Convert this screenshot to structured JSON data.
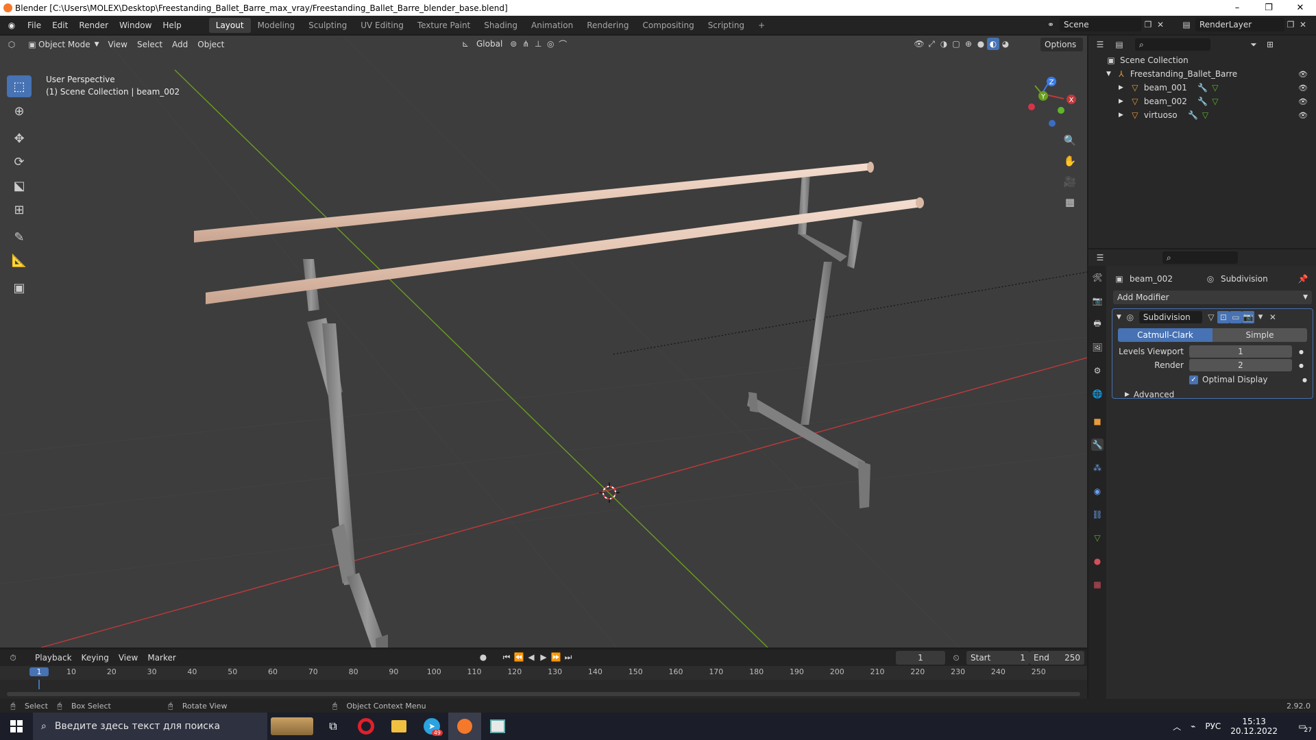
{
  "window": {
    "title": "Blender [C:\\Users\\MOLEX\\Desktop\\Freestanding_Ballet_Barre_max_vray/Freestanding_Ballet_Barre_blender_base.blend]",
    "minimize": "–",
    "maximize": "❐",
    "close": "✕"
  },
  "menu": {
    "items": [
      "File",
      "Edit",
      "Render",
      "Window",
      "Help"
    ],
    "workspaces": [
      "Layout",
      "Modeling",
      "Sculpting",
      "UV Editing",
      "Texture Paint",
      "Shading",
      "Animation",
      "Rendering",
      "Compositing",
      "Scripting"
    ],
    "active_workspace": "Layout",
    "add_workspace": "+",
    "scene": "Scene",
    "render_layer": "RenderLayer"
  },
  "viewport_header": {
    "mode": "Object Mode",
    "menus": [
      "View",
      "Select",
      "Add",
      "Object"
    ],
    "orientation": "Global",
    "options": "Options"
  },
  "viewport": {
    "perspective": "User Perspective",
    "collection_info": "(1) Scene Collection | beam_002",
    "gizmo_axes": [
      "X",
      "Y",
      "Z"
    ]
  },
  "outliner": {
    "root": "Scene Collection",
    "collection": "Freestanding_Ballet_Barre",
    "objects": [
      "beam_001",
      "beam_002",
      "virtuoso"
    ]
  },
  "properties": {
    "object_name": "beam_002",
    "modifier_tab_name": "Subdivision",
    "add_modifier": "Add Modifier",
    "modifier": {
      "name": "Subdivision",
      "types": [
        "Catmull-Clark",
        "Simple"
      ],
      "active_type": "Catmull-Clark",
      "levels_viewport_label": "Levels Viewport",
      "levels_viewport": "1",
      "render_label": "Render",
      "render": "2",
      "optimal_display_label": "Optimal Display",
      "optimal_display": true,
      "advanced_label": "Advanced"
    }
  },
  "timeline": {
    "menus": [
      "Playback",
      "Keying",
      "View",
      "Marker"
    ],
    "current_frame": "1",
    "start_label": "Start",
    "start": "1",
    "end_label": "End",
    "end": "250",
    "ticks": [
      "1",
      "10",
      "20",
      "30",
      "40",
      "50",
      "60",
      "70",
      "80",
      "90",
      "100",
      "110",
      "120",
      "130",
      "140",
      "150",
      "160",
      "170",
      "180",
      "190",
      "200",
      "210",
      "220",
      "230",
      "240",
      "250"
    ]
  },
  "statusbar": {
    "select": "Select",
    "box_select": "Box Select",
    "rotate_view": "Rotate View",
    "context_menu": "Object Context Menu",
    "version": "2.92.0"
  },
  "taskbar": {
    "search_placeholder": "Введите здесь текст для поиска",
    "language": "РУС",
    "time": "15:13",
    "date": "20.12.2022",
    "notification_count": "27",
    "telegram_badge": "49"
  },
  "colors": {
    "accent": "#4772b3",
    "viewport_bg": "#3d3d3d",
    "x_axis": "#c0393b",
    "y_axis": "#6a9e1f",
    "z_axis": "#3b7ce6",
    "wood": "#e8cbb7",
    "metal": "#8a8a8a"
  }
}
